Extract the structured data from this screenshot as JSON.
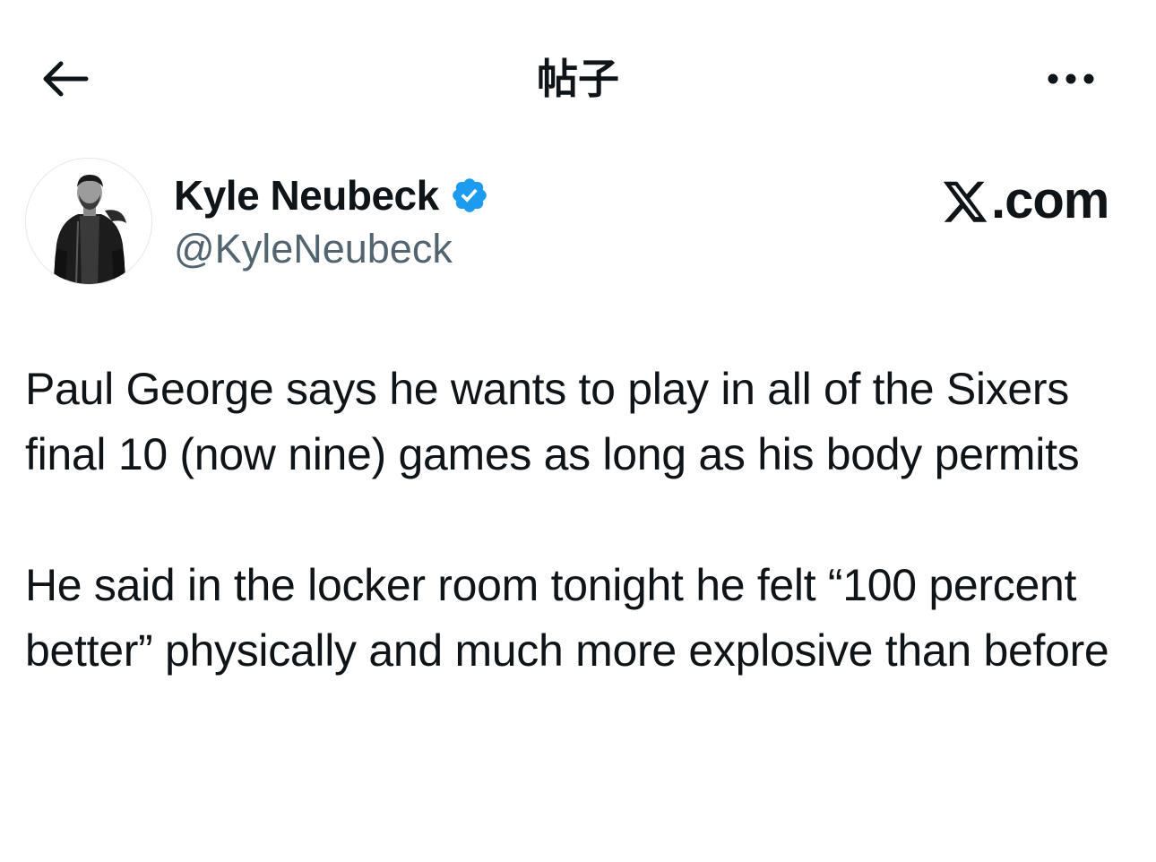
{
  "header": {
    "title": "帖子",
    "back_icon": "arrow-left-icon",
    "more_icon": "more-horizontal-icon"
  },
  "author": {
    "name": "Kyle Neubeck",
    "handle": "@KyleNeubeck",
    "verified": true,
    "verified_color": "#1d9bf0",
    "avatar_icon": "profile-photo"
  },
  "brand": {
    "label": ".com",
    "icon": "x-logo-icon"
  },
  "tweet": {
    "paragraphs": [
      "Paul George says he wants to play in all of the Sixers final 10 (now nine) games as long as his body permits",
      "He said in the locker room tonight he felt “100 percent better” physically and much more explosive than before"
    ]
  },
  "colors": {
    "text_primary": "#0f1419",
    "text_secondary": "#536471",
    "background": "#ffffff"
  }
}
